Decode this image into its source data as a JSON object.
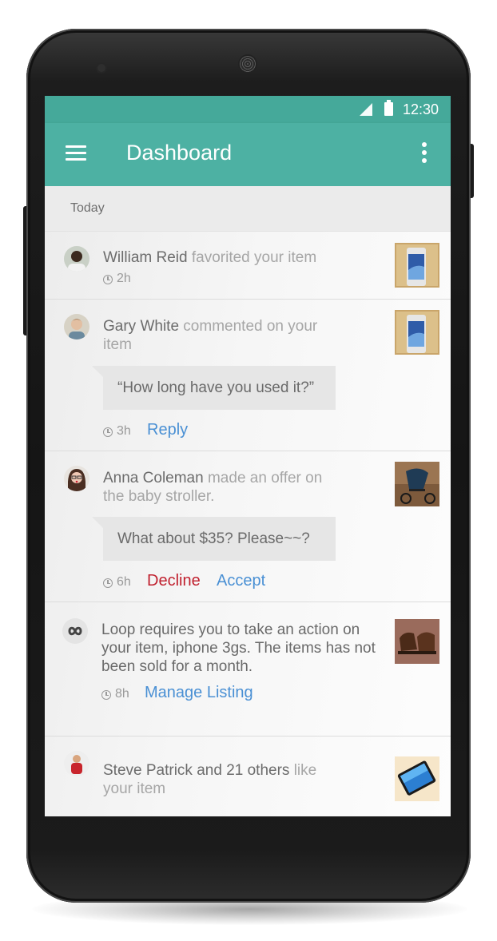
{
  "status_bar": {
    "time": "12:30"
  },
  "app_bar": {
    "title": "Dashboard"
  },
  "section": {
    "label": "Today"
  },
  "notifications": [
    {
      "name": "William Reid",
      "action": " favorited your item",
      "time": "2h"
    },
    {
      "name": "Gary White",
      "action": " commented on your item",
      "comment": "“How long have you used it?”",
      "time": "3h",
      "reply_label": "Reply"
    },
    {
      "name": "Anna Coleman",
      "action": " made an offer on the baby stroller.",
      "comment": "What about $35? Please~~?",
      "time": "6h",
      "decline_label": "Decline",
      "accept_label": "Accept"
    },
    {
      "text": "Loop requires you to take an action on your item, iphone 3gs. The items has not been sold for a month.",
      "time": "8h",
      "manage_label": "Manage Listing"
    },
    {
      "name": "Steve Patrick and 21 others",
      "action": " like your item"
    }
  ],
  "colors": {
    "accent": "#4db1a3",
    "status_bar": "#45a99a",
    "link": "#4a90d4",
    "decline": "#c0202e"
  },
  "icons": [
    "menu-icon",
    "overflow-menu-icon",
    "signal-icon",
    "battery-icon",
    "clock-icon",
    "loop-logo-icon"
  ]
}
